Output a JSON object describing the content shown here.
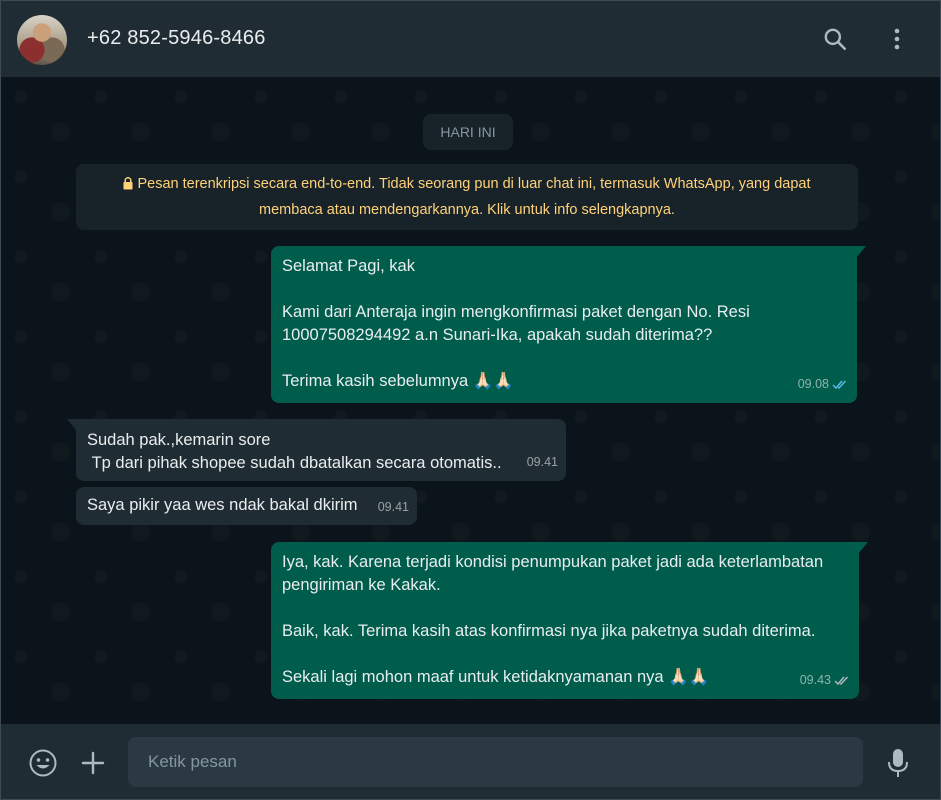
{
  "header": {
    "contact_name": "+62 852-5946-8466",
    "icons": [
      "avatar",
      "search-icon",
      "menu-kebab-icon"
    ]
  },
  "chat": {
    "day_label": "HARI INI",
    "encryption_notice": "Pesan terenkripsi secara end-to-end. Tidak seorang pun di luar chat ini, termasuk WhatsApp, yang dapat membaca atau mendengarkannya. Klik untuk info selengkapnya.",
    "messages": [
      {
        "direction": "out",
        "text": "Selamat Pagi, kak\n\nKami dari Anteraja ingin mengkonfirmasi paket dengan No. Resi 10007508294492 a.n Sunari-Ika, apakah sudah diterima??\n\nTerima kasih sebelumnya 🙏🏻🙏🏻",
        "time": "09.08",
        "status": "read"
      },
      {
        "direction": "in",
        "text": "Sudah pak.,kemarin sore\n Tp dari pihak shopee sudah dbatalkan secara otomatis..",
        "time": "09.41"
      },
      {
        "direction": "in",
        "text": "Saya pikir yaa wes ndak bakal dkirim",
        "time": "09.41"
      },
      {
        "direction": "out",
        "text": "Iya, kak. Karena terjadi kondisi penumpukan paket jadi ada keterlambatan pengiriman ke Kakak.\n\nBaik, kak. Terima kasih atas konfirmasi nya jika paketnya sudah diterima.\n\nSekali lagi mohon maaf untuk ketidaknyamanan nya 🙏🏻🙏🏻",
        "time": "09.43",
        "status": "delivered"
      }
    ]
  },
  "composer": {
    "placeholder": "Ketik pesan",
    "value": "",
    "icons": [
      "emoji-icon",
      "plus-icon",
      "microphone-icon"
    ]
  },
  "colors": {
    "header_bg": "#202c33",
    "chat_bg": "#0b141a",
    "outgoing_bubble": "#005c4b",
    "incoming_bubble": "#202c33",
    "encryption_text": "#ffd279",
    "read_ticks": "#53bdeb"
  }
}
